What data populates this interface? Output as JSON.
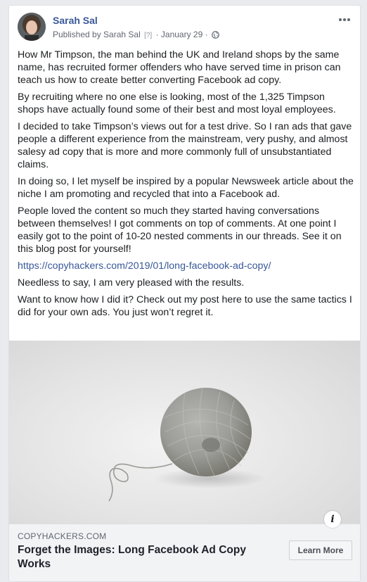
{
  "post": {
    "author": "Sarah Sal",
    "published_by": "Published by Sarah Sal",
    "help_marker": "[?]",
    "separator": "·",
    "date": "January 29",
    "paragraphs": [
      "How Mr Timpson, the man behind the UK and Ireland shops by the same name, has recruited former offenders who have served time in prison can teach us how to create better converting Facebook ad copy.",
      "By recruiting where no one else is looking, most of the 1,325 Timpson shops have actually found some of their best and most loyal employees.",
      "I decided to take Timpson’s views out for a test drive. So I ran ads that gave people a different experience from the mainstream, very pushy, and almost salesy ad copy that is more and more commonly full of unsubstantiated claims.",
      "In doing so, I let myself be inspired by a popular Newsweek article about the niche I am promoting and recycled that into a Facebook ad.",
      "People loved the content so much they started having conversations between themselves! I got comments on top of comments. At one point I easily got to the point of 10-20 nested comments in our threads. See it on this blog post for yourself!"
    ],
    "link_url": "https://copyhackers.com/2019/01/long-facebook-ad-copy/",
    "paragraphs_after": [
      "Needless to say, I am very pleased with the results.",
      "Want to know how I did it? Check out my post here to use the same tactics I did for your own ads. You just won’t regret it."
    ]
  },
  "link_preview": {
    "domain": "COPYHACKERS.COM",
    "title": "Forget the Images: Long Facebook Ad Copy Works",
    "cta_label": "Learn More",
    "info_glyph": "i"
  },
  "icons": {
    "more": "more-options-icon",
    "audience": "globe-icon",
    "info": "info-icon"
  },
  "colors": {
    "page_bg": "#e9ebee",
    "link": "#385898",
    "text": "#1c1e21",
    "meta": "#616770"
  }
}
